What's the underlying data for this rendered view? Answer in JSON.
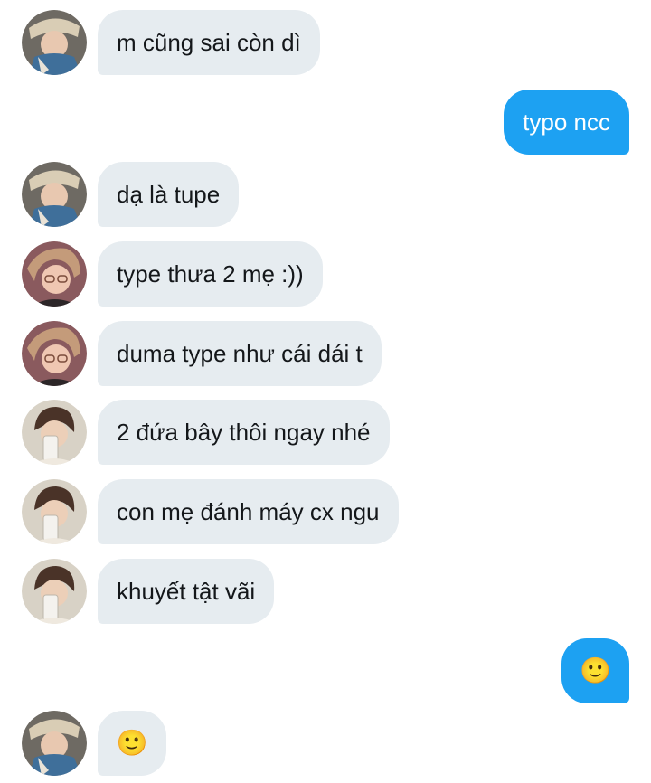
{
  "messages": [
    {
      "side": "in",
      "avatar": "avatar-a",
      "text": "m cũng sai còn dì"
    },
    {
      "side": "out",
      "text": "typo ncc"
    },
    {
      "side": "in",
      "avatar": "avatar-a",
      "text": "dạ là tupe"
    },
    {
      "side": "in",
      "avatar": "avatar-b",
      "text": "type thưa 2 mẹ :))"
    },
    {
      "side": "in",
      "avatar": "avatar-b",
      "text": "duma type như cái dái t"
    },
    {
      "side": "in",
      "avatar": "avatar-c",
      "text": "2 đứa bây thôi ngay nhé"
    },
    {
      "side": "in",
      "avatar": "avatar-c",
      "text": "con mẹ đánh máy cx ngu"
    },
    {
      "side": "in",
      "avatar": "avatar-c",
      "text": "khuyết tật vãi"
    },
    {
      "side": "out",
      "text": "🙂",
      "emoji": "slightly-smiling-face"
    },
    {
      "side": "in",
      "avatar": "avatar-a",
      "text": "🙂",
      "emoji": "slightly-smiling-face"
    }
  ],
  "colors": {
    "incoming_bubble": "#e6ecf0",
    "outgoing_bubble": "#1da1f2",
    "incoming_text": "#14171a",
    "outgoing_text": "#ffffff"
  }
}
